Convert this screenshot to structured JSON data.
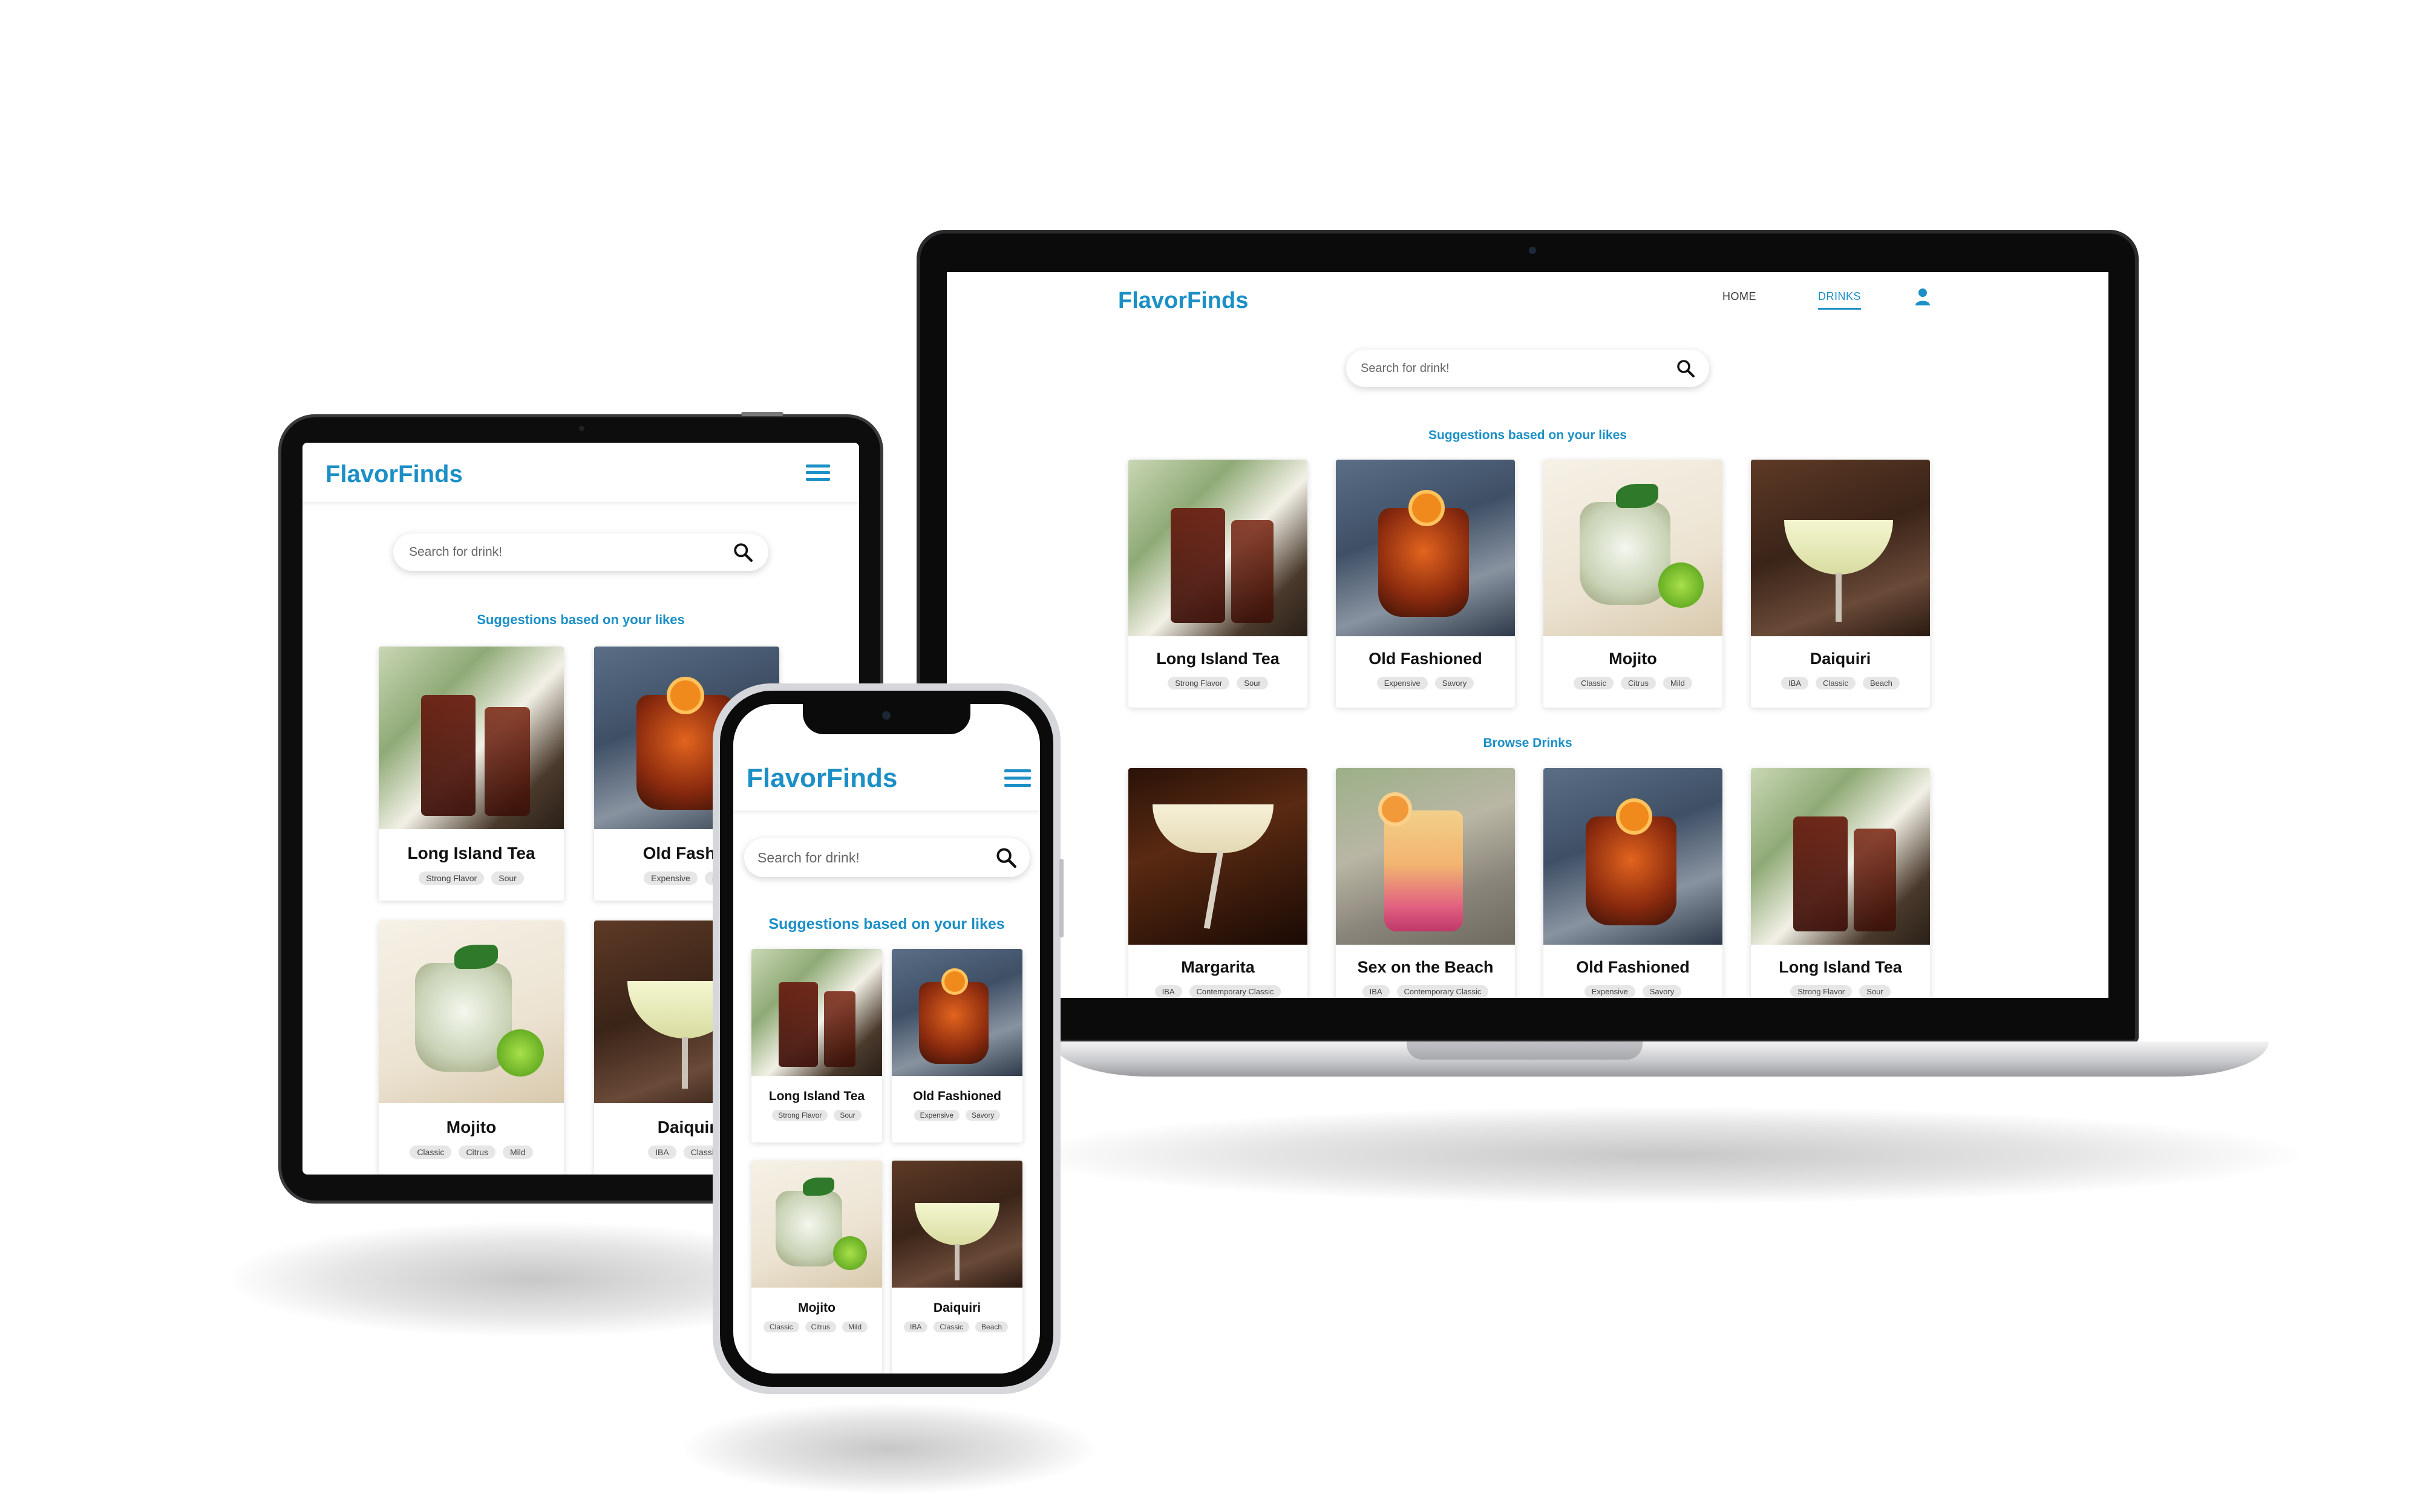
{
  "brand": "FlavorFinds",
  "nav": {
    "home": "HOME",
    "drinks": "DRINKS"
  },
  "search": {
    "placeholder": "Search for drink!"
  },
  "sections": {
    "suggestions": "Suggestions based on your likes",
    "browse": "Browse Drinks"
  },
  "colors": {
    "accent": "#1b8fc6"
  },
  "icons": {
    "search": "search-icon",
    "user": "user-icon",
    "menu": "hamburger-menu-icon"
  },
  "suggested": [
    {
      "name": "Long Island Tea",
      "tags": [
        "Strong Flavor",
        "Sour"
      ]
    },
    {
      "name": "Old Fashioned",
      "tags": [
        "Expensive",
        "Savory"
      ]
    },
    {
      "name": "Mojito",
      "tags": [
        "Classic",
        "Citrus",
        "Mild"
      ]
    },
    {
      "name": "Daiquiri",
      "tags": [
        "IBA",
        "Classic",
        "Beach"
      ]
    }
  ],
  "browse": [
    {
      "name": "Margarita",
      "tags": [
        "IBA",
        "Contemporary Classic"
      ]
    },
    {
      "name": "Sex on the Beach",
      "tags": [
        "IBA",
        "Contemporary Classic"
      ]
    },
    {
      "name": "Old Fashioned",
      "tags": [
        "Expensive",
        "Savory"
      ]
    },
    {
      "name": "Long Island Tea",
      "tags": [
        "Strong Flavor",
        "Sour"
      ]
    }
  ],
  "tablet_visible": {
    "old_fashioned_name": "Old Fashio",
    "old_fashioned_tags": [
      "Expensive",
      "Sa"
    ],
    "daiquiri_name": "Daiquir",
    "daiquiri_tags": [
      "IBA",
      "Classic"
    ]
  }
}
